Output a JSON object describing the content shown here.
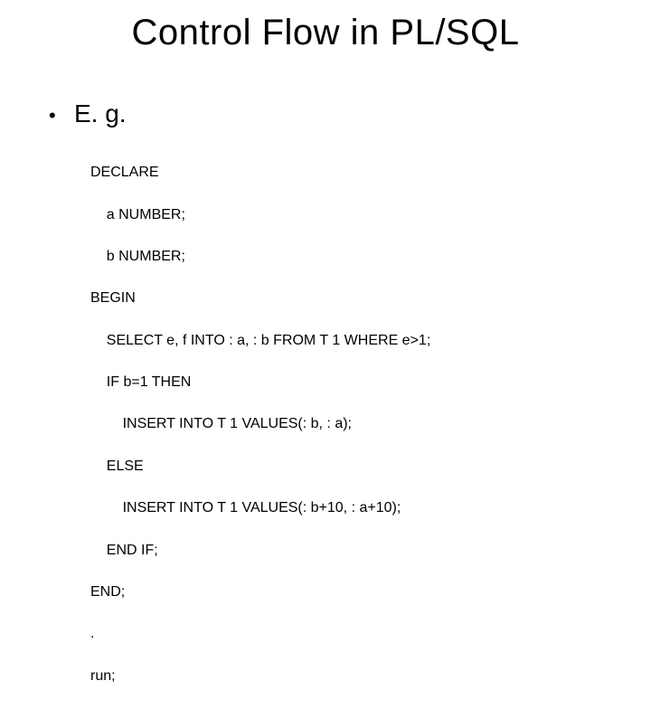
{
  "title": "Control Flow in PL/SQL",
  "bullet": {
    "marker": "•",
    "label": "E. g."
  },
  "code": {
    "l01": "DECLARE",
    "l02": "    a NUMBER;",
    "l03": "    b NUMBER;",
    "l04": "BEGIN",
    "l05": "    SELECT e, f INTO : a, : b FROM T 1 WHERE e>1;",
    "l06": "    IF b=1 THEN",
    "l07": "        INSERT INTO T 1 VALUES(: b, : a);",
    "l08": "    ELSE",
    "l09": "        INSERT INTO T 1 VALUES(: b+10, : a+10);",
    "l10": "    END IF;",
    "l11": "END;",
    "l12": ".",
    "l13": "run;"
  }
}
